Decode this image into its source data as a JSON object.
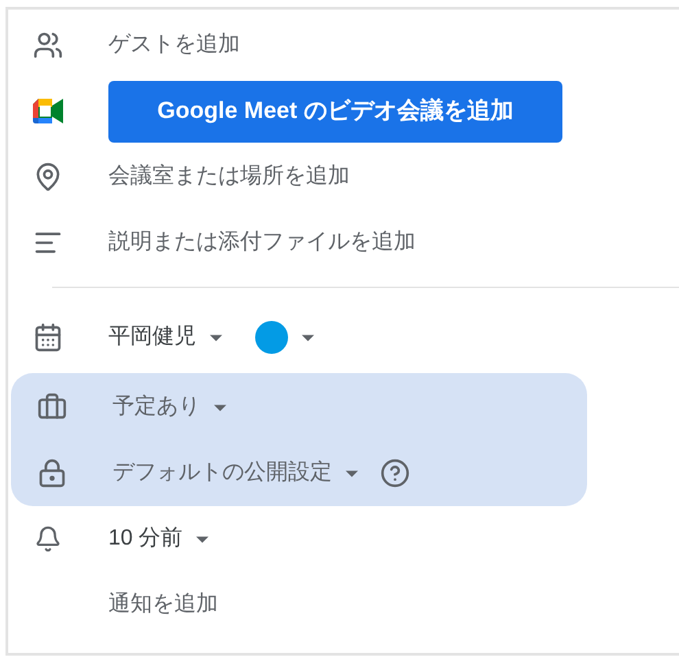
{
  "guests": {
    "placeholder": "ゲストを追加"
  },
  "meet_button": {
    "label": "Google Meet のビデオ会議を追加"
  },
  "location": {
    "placeholder": "会議室または場所を追加"
  },
  "description": {
    "placeholder": "説明または添付ファイルを追加"
  },
  "calendar": {
    "owner": "平岡健児",
    "color": "#039be5"
  },
  "busy_status": {
    "value": "予定あり"
  },
  "visibility": {
    "value": "デフォルトの公開設定"
  },
  "notification": {
    "value": "10 分前"
  },
  "add_notification": {
    "label": "通知を追加"
  }
}
